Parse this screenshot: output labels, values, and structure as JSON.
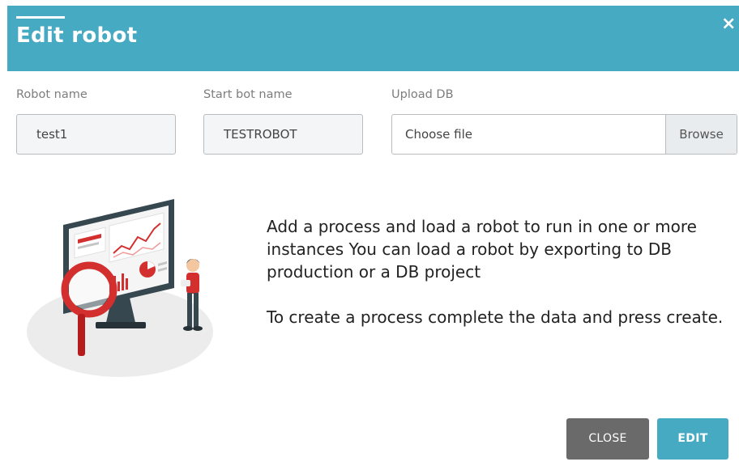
{
  "header": {
    "title": "Edit robot",
    "close_symbol": "×"
  },
  "form": {
    "robot_name": {
      "label": "Robot name",
      "value": "test1"
    },
    "start_bot_name": {
      "label": "Start bot name",
      "value": "TESTROBOT"
    },
    "upload_db": {
      "label": "Upload DB",
      "placeholder": "Choose file",
      "browse_label": "Browse"
    }
  },
  "message": {
    "paragraph1": "Add a process and load a robot to run in one or more instances You can load a robot by exporting to DB production or a DB project",
    "paragraph2": "To create a process complete the data and press create."
  },
  "footer": {
    "close_label": "CLOSE",
    "edit_label": "EDIT"
  },
  "colors": {
    "header_bg": "#47aac3",
    "edit_button": "#47aac3",
    "close_button": "#6a6a6a",
    "illustration_accent": "#d32f2f"
  },
  "icons": {
    "close": "close-icon",
    "illustration": "data-analysis-illustration"
  }
}
